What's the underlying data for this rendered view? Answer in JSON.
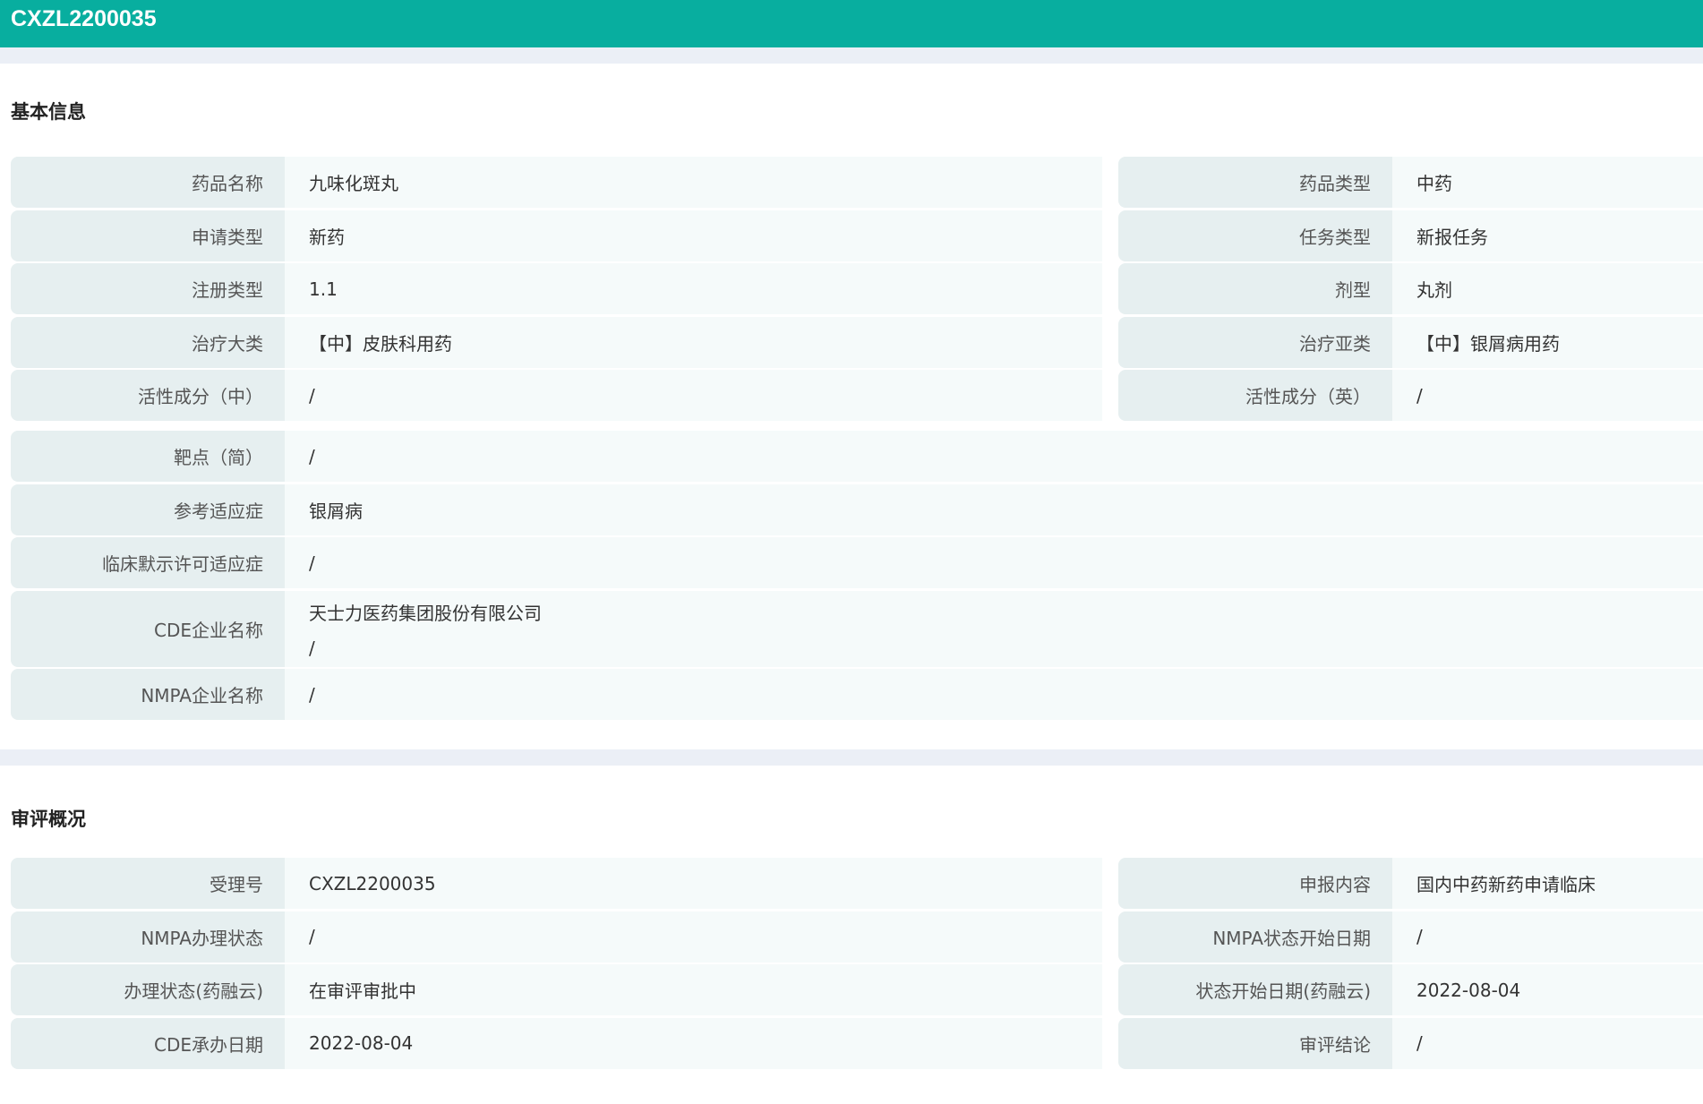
{
  "header": {
    "title": "CXZL2200035"
  },
  "basic": {
    "title": "基本信息",
    "pairs": [
      [
        "药品名称",
        "九味化斑丸",
        "药品类型",
        "中药"
      ],
      [
        "申请类型",
        "新药",
        "任务类型",
        "新报任务"
      ],
      [
        "注册类型",
        "1.1",
        "剂型",
        "丸剂"
      ],
      [
        "治疗大类",
        "【中】皮肤科用药",
        "治疗亚类",
        "【中】银屑病用药"
      ],
      [
        "活性成分（中）",
        "/",
        "活性成分（英）",
        "/"
      ]
    ],
    "full": [
      [
        "靶点（简）",
        "/"
      ],
      [
        "参考适应症",
        "银屑病"
      ],
      [
        "临床默示许可适应症",
        "/"
      ]
    ],
    "cde": {
      "label": "CDE企业名称",
      "line1": "天士力医药集团股份有限公司",
      "line2": "/"
    },
    "nmpa": {
      "label": "NMPA企业名称",
      "value": "/"
    }
  },
  "review": {
    "title": "审评概况",
    "pairs": [
      [
        "受理号",
        "CXZL2200035",
        "申报内容",
        "国内中药新药申请临床"
      ],
      [
        "NMPA办理状态",
        "/",
        "NMPA状态开始日期",
        "/"
      ],
      [
        "办理状态(药融云)",
        "在审评审批中",
        "状态开始日期(药融云)",
        "2022-08-04"
      ],
      [
        "CDE承办日期",
        "2022-08-04",
        "审评结论",
        "/"
      ]
    ]
  }
}
